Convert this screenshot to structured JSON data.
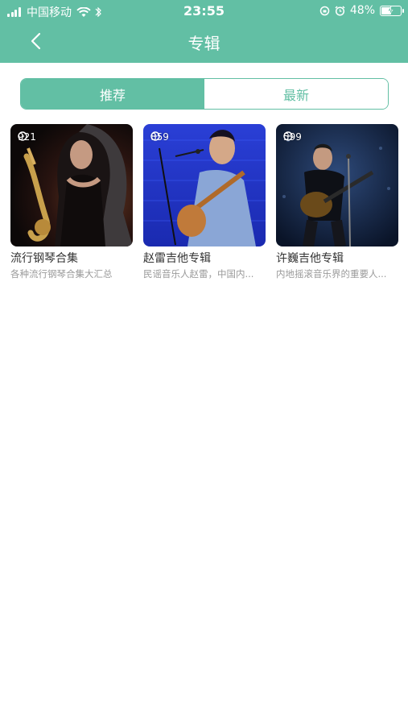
{
  "status_bar": {
    "carrier": "中国移动",
    "time": "23:55",
    "battery": "48%"
  },
  "nav": {
    "title": "专辑"
  },
  "tabs": [
    {
      "label": "推荐",
      "active": true
    },
    {
      "label": "最新",
      "active": false
    }
  ],
  "albums": [
    {
      "plays": "921",
      "title": "流行钢琴合集",
      "desc": "各种流行钢琴合集大汇总"
    },
    {
      "plays": "859",
      "title": "赵雷吉他专辑",
      "desc": "民谣音乐人赵雷，中国内..."
    },
    {
      "plays": "599",
      "title": "许巍吉他专辑",
      "desc": "内地摇滚音乐界的重要人..."
    }
  ],
  "colors": {
    "accent": "#62bfa4"
  }
}
